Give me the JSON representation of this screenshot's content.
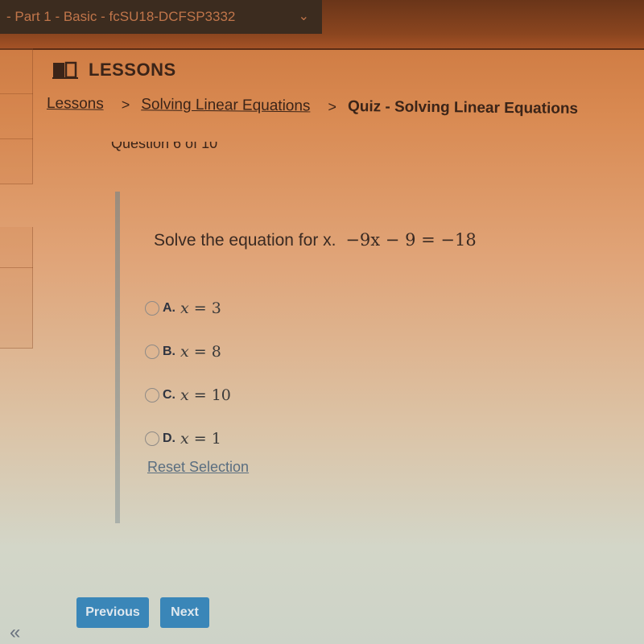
{
  "topbar": {
    "course_selector": "- Part 1 - Basic - fcSU18-DCFSP3332",
    "course_selector_icon": "chevron-down-icon"
  },
  "header": {
    "icon": "book-icon",
    "title": "LESSONS"
  },
  "breadcrumb": {
    "items": [
      {
        "label": "Lessons",
        "link": true
      },
      {
        "label": "Solving Linear Equations",
        "link": true
      },
      {
        "label": "Quiz - Solving Linear Equations",
        "link": false
      }
    ],
    "separator": ">"
  },
  "quiz": {
    "question_counter": "Question 6 of 10",
    "prompt": "Solve the equation for x.",
    "equation": "−9x − 9 = −18",
    "options": [
      {
        "letter": "A.",
        "var": "x",
        "rel": " = ",
        "value": "3",
        "selected": false
      },
      {
        "letter": "B.",
        "var": "x",
        "rel": " = ",
        "value": "8",
        "selected": false
      },
      {
        "letter": "C.",
        "var": "x",
        "rel": " = ",
        "value": "10",
        "selected": false
      },
      {
        "letter": "D.",
        "var": "x",
        "rel": " = ",
        "value": "1",
        "selected": false
      }
    ],
    "reset_label": "Reset Selection"
  },
  "navigation": {
    "previous_label": "Previous",
    "next_label": "Next",
    "collapse_icon": "double-chevron-left-icon",
    "collapse_glyph": "«"
  },
  "colors": {
    "button_bg": "#3a86b8",
    "link": "#5a6e80",
    "text": "#3b2418"
  }
}
